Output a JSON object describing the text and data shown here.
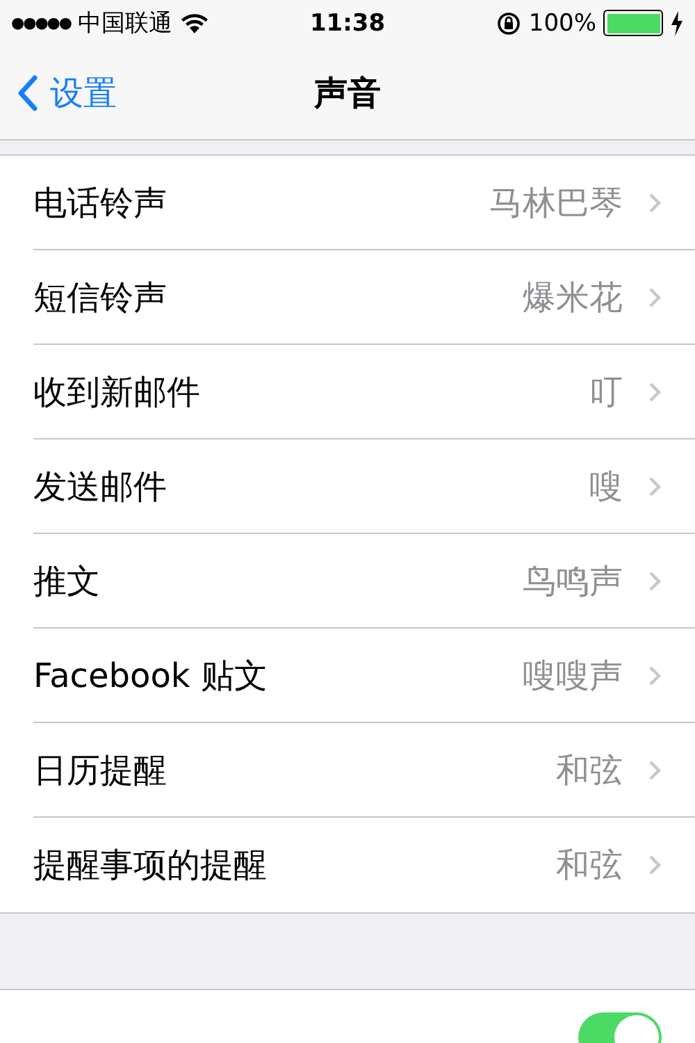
{
  "status_bar": {
    "signal_dots": "●●●●●",
    "carrier": "中国联通",
    "time": "11:38",
    "battery_percent": "100%"
  },
  "nav": {
    "back_label": "设置",
    "title": "声音"
  },
  "rows": [
    {
      "label": "电话铃声",
      "value": "马林巴琴"
    },
    {
      "label": "短信铃声",
      "value": "爆米花"
    },
    {
      "label": "收到新邮件",
      "value": "叮"
    },
    {
      "label": "发送邮件",
      "value": "嗖"
    },
    {
      "label": "推文",
      "value": "鸟鸣声"
    },
    {
      "label": "Facebook 贴文",
      "value": "嗖嗖声"
    },
    {
      "label": "日历提醒",
      "value": "和弦"
    },
    {
      "label": "提醒事项的提醒",
      "value": "和弦"
    }
  ],
  "toggle_row": {
    "on": true
  }
}
